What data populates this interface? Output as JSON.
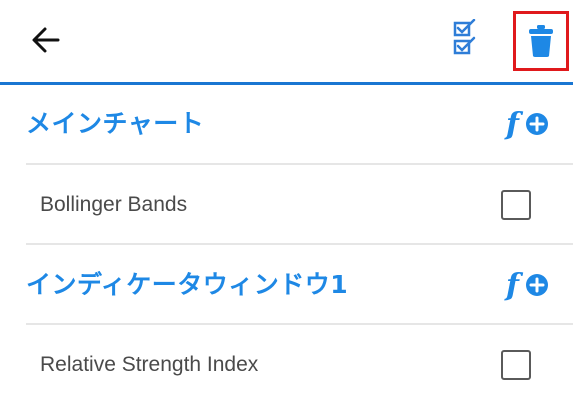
{
  "toolbar": {
    "back_icon": "arrow-left-icon",
    "select_icon": "checklist-icon",
    "delete_icon": "trash-icon",
    "accent_color": "#1e88e5",
    "highlight_color": "#e0191c"
  },
  "sections": [
    {
      "title": "メインチャート",
      "add_icon": "function-add-icon",
      "items": [
        {
          "label": "Bollinger Bands",
          "checked": false
        }
      ]
    },
    {
      "title": "インディケータウィンドウ1",
      "add_icon": "function-add-icon",
      "items": [
        {
          "label": "Relative Strength Index",
          "checked": false
        }
      ]
    }
  ]
}
